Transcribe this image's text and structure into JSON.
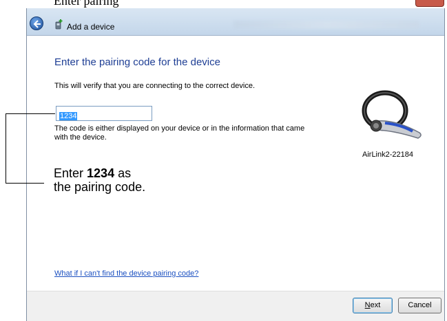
{
  "caption_top": "Enter pairing",
  "window": {
    "title": "Add a device"
  },
  "content": {
    "heading": "Enter the pairing code for the device",
    "description": "This will verify that you are connecting to the correct device.",
    "code_value": "1234",
    "hint": "The code is either displayed on your device or in the information that came with the device.",
    "device_name": "AirLink2-22184",
    "help_link": "What if I can't find the device pairing code?"
  },
  "footer": {
    "next_prefix": "N",
    "next_rest": "ext",
    "cancel_label": "Cancel"
  },
  "callout": {
    "line1_prefix": "Enter ",
    "line1_bold": "1234",
    "line1_suffix": " as",
    "line2": "the pairing code."
  }
}
